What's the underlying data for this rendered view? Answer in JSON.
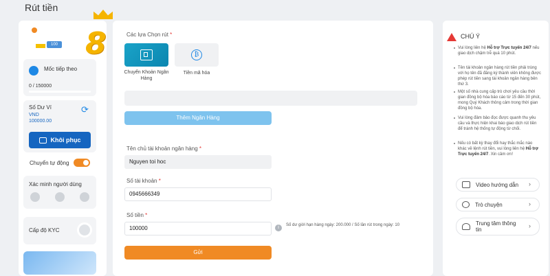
{
  "page_title": "Rút tiền",
  "logo": {
    "badge": "100",
    "brand_char": "8"
  },
  "left": {
    "milestone_label": "Mốc tiếp theo",
    "milestone_progress": "0 / 150000",
    "milestone_fraction": 0,
    "balance_label": "Số Dư Ví",
    "balance_currency": "VND",
    "balance_amount": "100000.00",
    "restore_label": "Khôi phục",
    "auto_transfer_label": "Chuyển tự động",
    "auto_transfer_on": true,
    "verify_label": "Xác minh người dùng",
    "kyc_label": "Cấp độ KYC"
  },
  "form": {
    "method_label": "Các lựa Chọn rút",
    "methods": [
      {
        "label": "Chuyển Khoản Ngân Hàng",
        "icon": "bank-icon",
        "selected": true
      },
      {
        "label": "Tiền mã hóa",
        "icon": "crypto-icon",
        "selected": false
      }
    ],
    "add_bank": "Thêm Ngân Hàng",
    "holder_label": "Tên chủ tài khoản ngân hàng",
    "holder_value": "Nguyen toi hoc",
    "account_label": "Số tài khoản",
    "account_value": "0945666349",
    "amount_label": "Số tiền",
    "amount_value": "100000",
    "limit_note": "Số dư giới hạn hàng ngày: 200.000 / Số lần rút trong ngày: 10",
    "submit": "Gửi",
    "required_mark": "*"
  },
  "notice": {
    "title": "CHÚ Ý",
    "items": [
      {
        "pre": "Vui lòng liên hệ ",
        "hl": "Hỗ trợ Trực tuyến 24/7",
        "post": " nếu giao dịch chậm trễ quá 10 phút."
      },
      {
        "pre": "Tên tài khoản ngân hàng rút tiền phải trùng với họ tên đã đăng ký thành viên không được phép rút tiền sang tài khoản ngân hàng bên thứ 3.",
        "hl": "",
        "post": ""
      },
      {
        "pre": "Một số nhà cung cấp trò chơi yêu cầu thời gian đồng bộ hóa báo cáo từ 15 đến 30 phút, mong Quý Khách thông cảm trong thời gian đồng bộ hóa.",
        "hl": "",
        "post": ""
      },
      {
        "pre": "Vui lòng đảm bảo đọc được quanh thu yêu cầu và thực hiện khai báo giao dịch rút tiền để tránh hệ thống tự động từ chối.",
        "hl": "",
        "post": ""
      },
      {
        "pre": "Nếu có bất kỳ thay đổi hay thắc mắc nào khác về lệnh rút tiền, vui lòng liên hệ ",
        "hl": "Hỗ trợ Trực tuyến 24/7",
        "post": ". Xin cảm ơn!"
      }
    ],
    "links": [
      {
        "label": "Video hướng dẫn",
        "icon": "video-icon"
      },
      {
        "label": "Trò chuyện",
        "icon": "chat-icon"
      },
      {
        "label": "Trung tâm thông tin",
        "icon": "info-center-icon"
      }
    ]
  },
  "colors": {
    "accent": "#f08a24",
    "primary": "#1565c0",
    "light_blue": "#7ec3ee",
    "warning": "#e53935"
  }
}
